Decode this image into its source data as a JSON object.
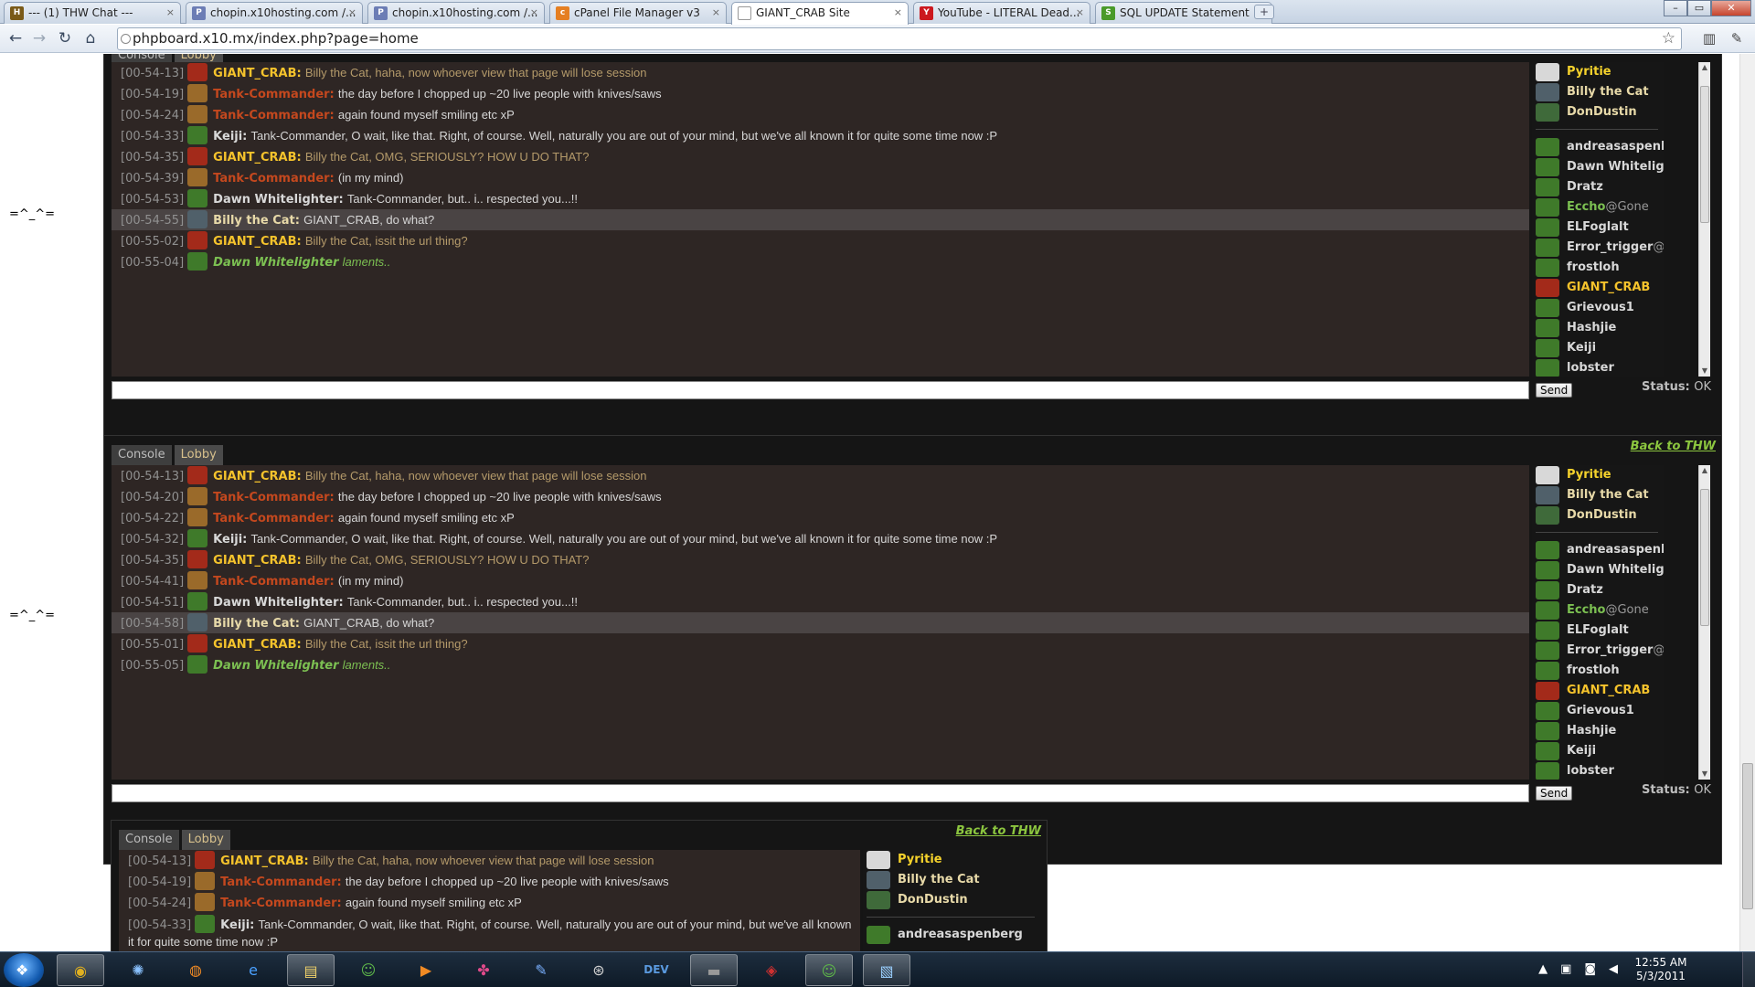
{
  "browser": {
    "tabs": [
      {
        "title": "--- (1) THW Chat ---",
        "fav": "H",
        "color": "#7a5a18"
      },
      {
        "title": "chopin.x10hosting.com /...",
        "fav": "P",
        "color": "#6c7db5"
      },
      {
        "title": "chopin.x10hosting.com /...",
        "fav": "P",
        "color": "#6c7db5"
      },
      {
        "title": "cPanel File Manager v3",
        "fav": "c",
        "color": "#e57f22"
      },
      {
        "title": "GIANT_CRAB Site",
        "fav": "",
        "color": "#ffffff"
      },
      {
        "title": "YouTube - LITERAL Dead...",
        "fav": "Y",
        "color": "#cc181e"
      },
      {
        "title": "SQL UPDATE Statement",
        "fav": "S",
        "color": "#4a9a2a"
      }
    ],
    "new_tab": "+",
    "url": "phpboard.x10.mx/index.php?page=home",
    "win_min": "–",
    "win_max": "▭",
    "win_close": "✕"
  },
  "page": {
    "side_label": "=^_^=",
    "separator": ":",
    "tab_console": "Console",
    "tab_lobby": "Lobby",
    "back_link": "Back to THW",
    "send": "Send",
    "status_label": "Status:",
    "status_value": "OK",
    "chat1_messages": [
      {
        "ts": "[00-54-13]",
        "name": "GIANT_CRAB:",
        "text": "Billy the Cat, haha, now whoever view that page will lose session",
        "nc": "#f5c32c",
        "tc": "#b49a6a",
        "av": "#a32a1a"
      },
      {
        "ts": "[00-54-19]",
        "name": "Tank-Commander:",
        "text": "the day before I chopped up ~20 live people with knives/saws",
        "nc": "#c4481e",
        "tc": "#d6d6d6",
        "av": "#9a6a2a"
      },
      {
        "ts": "[00-54-24]",
        "name": "Tank-Commander:",
        "text": "again found myself smiling etc xP",
        "nc": "#c4481e",
        "tc": "#d6d6d6",
        "av": "#9a6a2a"
      },
      {
        "ts": "[00-54-33]",
        "name": "Keiji:",
        "text": "Tank-Commander, O wait, like that. Right, of course. Well, naturally you are out of your mind, but we've all known it for quite some time now :P",
        "nc": "#d8d8d8",
        "tc": "#d6d6d6",
        "av": "#3f7a2a"
      },
      {
        "ts": "[00-54-35]",
        "name": "GIANT_CRAB:",
        "text": "Billy the Cat, OMG, SERIOUSLY? HOW U DO THAT?",
        "nc": "#f5c32c",
        "tc": "#b49a6a",
        "av": "#a32a1a"
      },
      {
        "ts": "[00-54-39]",
        "name": "Tank-Commander:",
        "text": "(in my mind)",
        "nc": "#c4481e",
        "tc": "#d6d6d6",
        "av": "#9a6a2a"
      },
      {
        "ts": "[00-54-53]",
        "name": "Dawn Whitelighter:",
        "text": "Tank-Commander, but.. i.. respected you...!!",
        "nc": "#d8d8d8",
        "tc": "#d6d6d6",
        "av": "#3f7a2a"
      },
      {
        "ts": "[00-54-55]",
        "name": "Billy the Cat:",
        "text": "GIANT_CRAB, do what?",
        "nc": "#e7d9a8",
        "tc": "#d6d6d6",
        "av": "#50606a",
        "hl": true
      },
      {
        "ts": "[00-55-02]",
        "name": "GIANT_CRAB:",
        "text": "Billy the Cat, issit the url thing?",
        "nc": "#f5c32c",
        "tc": "#b49a6a",
        "av": "#a32a1a"
      },
      {
        "ts": "[00-55-04]",
        "name": "Dawn Whitelighter",
        "text": "laments..",
        "nc": "#7cc052",
        "tc": "#7cc052",
        "av": "#3f7a2a",
        "italic": true
      }
    ],
    "chat2_messages": [
      {
        "ts": "[00-54-13]",
        "name": "GIANT_CRAB:",
        "text": "Billy the Cat, haha, now whoever view that page will lose session",
        "nc": "#f5c32c",
        "tc": "#b49a6a",
        "av": "#a32a1a"
      },
      {
        "ts": "[00-54-20]",
        "name": "Tank-Commander:",
        "text": "the day before I chopped up ~20 live people with knives/saws",
        "nc": "#c4481e",
        "tc": "#d6d6d6",
        "av": "#9a6a2a"
      },
      {
        "ts": "[00-54-22]",
        "name": "Tank-Commander:",
        "text": "again found myself smiling etc xP",
        "nc": "#c4481e",
        "tc": "#d6d6d6",
        "av": "#9a6a2a"
      },
      {
        "ts": "[00-54-32]",
        "name": "Keiji:",
        "text": "Tank-Commander, O wait, like that. Right, of course. Well, naturally you are out of your mind, but we've all known it for quite some time now :P",
        "nc": "#d8d8d8",
        "tc": "#d6d6d6",
        "av": "#3f7a2a"
      },
      {
        "ts": "[00-54-35]",
        "name": "GIANT_CRAB:",
        "text": "Billy the Cat, OMG, SERIOUSLY? HOW U DO THAT?",
        "nc": "#f5c32c",
        "tc": "#b49a6a",
        "av": "#a32a1a"
      },
      {
        "ts": "[00-54-41]",
        "name": "Tank-Commander:",
        "text": "(in my mind)",
        "nc": "#c4481e",
        "tc": "#d6d6d6",
        "av": "#9a6a2a"
      },
      {
        "ts": "[00-54-51]",
        "name": "Dawn Whitelighter:",
        "text": "Tank-Commander, but.. i.. respected you...!!",
        "nc": "#d8d8d8",
        "tc": "#d6d6d6",
        "av": "#3f7a2a"
      },
      {
        "ts": "[00-54-58]",
        "name": "Billy the Cat:",
        "text": "GIANT_CRAB, do what?",
        "nc": "#e7d9a8",
        "tc": "#d6d6d6",
        "av": "#50606a",
        "hl": true
      },
      {
        "ts": "[00-55-01]",
        "name": "GIANT_CRAB:",
        "text": "Billy the Cat, issit the url thing?",
        "nc": "#f5c32c",
        "tc": "#b49a6a",
        "av": "#a32a1a"
      },
      {
        "ts": "[00-55-05]",
        "name": "Dawn Whitelighter",
        "text": "laments..",
        "nc": "#7cc052",
        "tc": "#7cc052",
        "av": "#3f7a2a",
        "italic": true
      }
    ],
    "chat3_messages": [
      {
        "ts": "[00-54-13]",
        "name": "GIANT_CRAB:",
        "text": "Billy the Cat, haha, now whoever view that page will lose session",
        "nc": "#f5c32c",
        "tc": "#b49a6a",
        "av": "#a32a1a"
      },
      {
        "ts": "[00-54-19]",
        "name": "Tank-Commander:",
        "text": "the day before I chopped up ~20 live people with knives/saws",
        "nc": "#c4481e",
        "tc": "#d6d6d6",
        "av": "#9a6a2a"
      },
      {
        "ts": "[00-54-24]",
        "name": "Tank-Commander:",
        "text": "again found myself smiling etc xP",
        "nc": "#c4481e",
        "tc": "#d6d6d6",
        "av": "#9a6a2a"
      },
      {
        "ts": "[00-54-33]",
        "name": "Keiji:",
        "text": "Tank-Commander, O wait, like that. Right, of course. Well, naturally you are out of your mind, but we've all known it for quite some time now :P",
        "nc": "#d8d8d8",
        "tc": "#d6d6d6",
        "av": "#3f7a2a",
        "wrap": true
      }
    ],
    "users_top": [
      {
        "name": "Pyritie",
        "color": "#f5d22c",
        "av": "#d8d8d8"
      },
      {
        "name": "Billy the Cat",
        "color": "#e7d9a8",
        "av": "#50606a"
      },
      {
        "name": "DonDustin",
        "color": "#e7d9a8",
        "av": "#3f6a3a"
      }
    ],
    "users_main": [
      {
        "name": "andreasaspenberg",
        "color": "#d8d8d8",
        "av": "#3f7a2a"
      },
      {
        "name": "Dawn Whitelighter",
        "color": "#d8d8d8",
        "av": "#3f7a2a"
      },
      {
        "name": "Dratz",
        "color": "#d8d8d8",
        "av": "#3f7a2a"
      },
      {
        "name": "Eccho",
        "status": "@Gone",
        "color": "#7cc052",
        "av": "#3f7a2a"
      },
      {
        "name": "ELFoglalt",
        "color": "#d8d8d8",
        "av": "#3f7a2a"
      },
      {
        "name": "Error_trigger",
        "status": "@?",
        "color": "#d8d8d8",
        "av": "#3f7a2a"
      },
      {
        "name": "frostloh",
        "color": "#d8d8d8",
        "av": "#3f7a2a"
      },
      {
        "name": "GIANT_CRAB",
        "color": "#f5c32c",
        "av": "#a32a1a"
      },
      {
        "name": "Grievous1",
        "color": "#d8d8d8",
        "av": "#3f7a2a"
      },
      {
        "name": "Hashjie",
        "color": "#d8d8d8",
        "av": "#3f7a2a"
      },
      {
        "name": "Keiji",
        "color": "#d8d8d8",
        "av": "#3f7a2a"
      },
      {
        "name": "lobster",
        "color": "#d8d8d8",
        "av": "#3f7a2a"
      }
    ],
    "users_small": [
      {
        "name": "andreasaspenberg",
        "color": "#d8d8d8",
        "av": "#3f7a2a"
      }
    ]
  },
  "taskbar": {
    "start_glyph": "❖",
    "items": [
      {
        "name": "chrome",
        "glyph": "◉",
        "color": "#e0b020",
        "open": true
      },
      {
        "name": "safari",
        "glyph": "✺",
        "color": "#8ac2ff",
        "open": false
      },
      {
        "name": "firefox",
        "glyph": "◍",
        "color": "#f08a24",
        "open": false
      },
      {
        "name": "ie",
        "glyph": "e",
        "color": "#4aa0ff",
        "open": false
      },
      {
        "name": "explorer",
        "glyph": "▤",
        "color": "#f2d36a",
        "open": true
      },
      {
        "name": "messenger",
        "glyph": "☺",
        "color": "#5fb84a",
        "open": false
      },
      {
        "name": "media",
        "glyph": "▶",
        "color": "#f08a24",
        "open": false
      },
      {
        "name": "app-colorful",
        "glyph": "✤",
        "color": "#e04a8a",
        "open": false
      },
      {
        "name": "app-pen",
        "glyph": "✎",
        "color": "#7ab0ff",
        "open": false
      },
      {
        "name": "steam",
        "glyph": "⊛",
        "color": "#d0d0d0",
        "open": false
      },
      {
        "name": "devcpp",
        "glyph": "DEV",
        "color": "#5a9ae0",
        "open": false
      },
      {
        "name": "terminal",
        "glyph": "▬",
        "color": "#999999",
        "open": true
      },
      {
        "name": "game-red",
        "glyph": "◈",
        "color": "#d03030",
        "open": false
      },
      {
        "name": "messenger-2",
        "glyph": "☺",
        "color": "#5fb84a",
        "open": true
      },
      {
        "name": "notes",
        "glyph": "▧",
        "color": "#9ad0ff",
        "open": true
      }
    ],
    "tray_up": "▲",
    "tray_network": "▣",
    "tray_shield": "◙",
    "tray_volume": "◀",
    "time": "12:55 AM",
    "date": "5/3/2011"
  }
}
